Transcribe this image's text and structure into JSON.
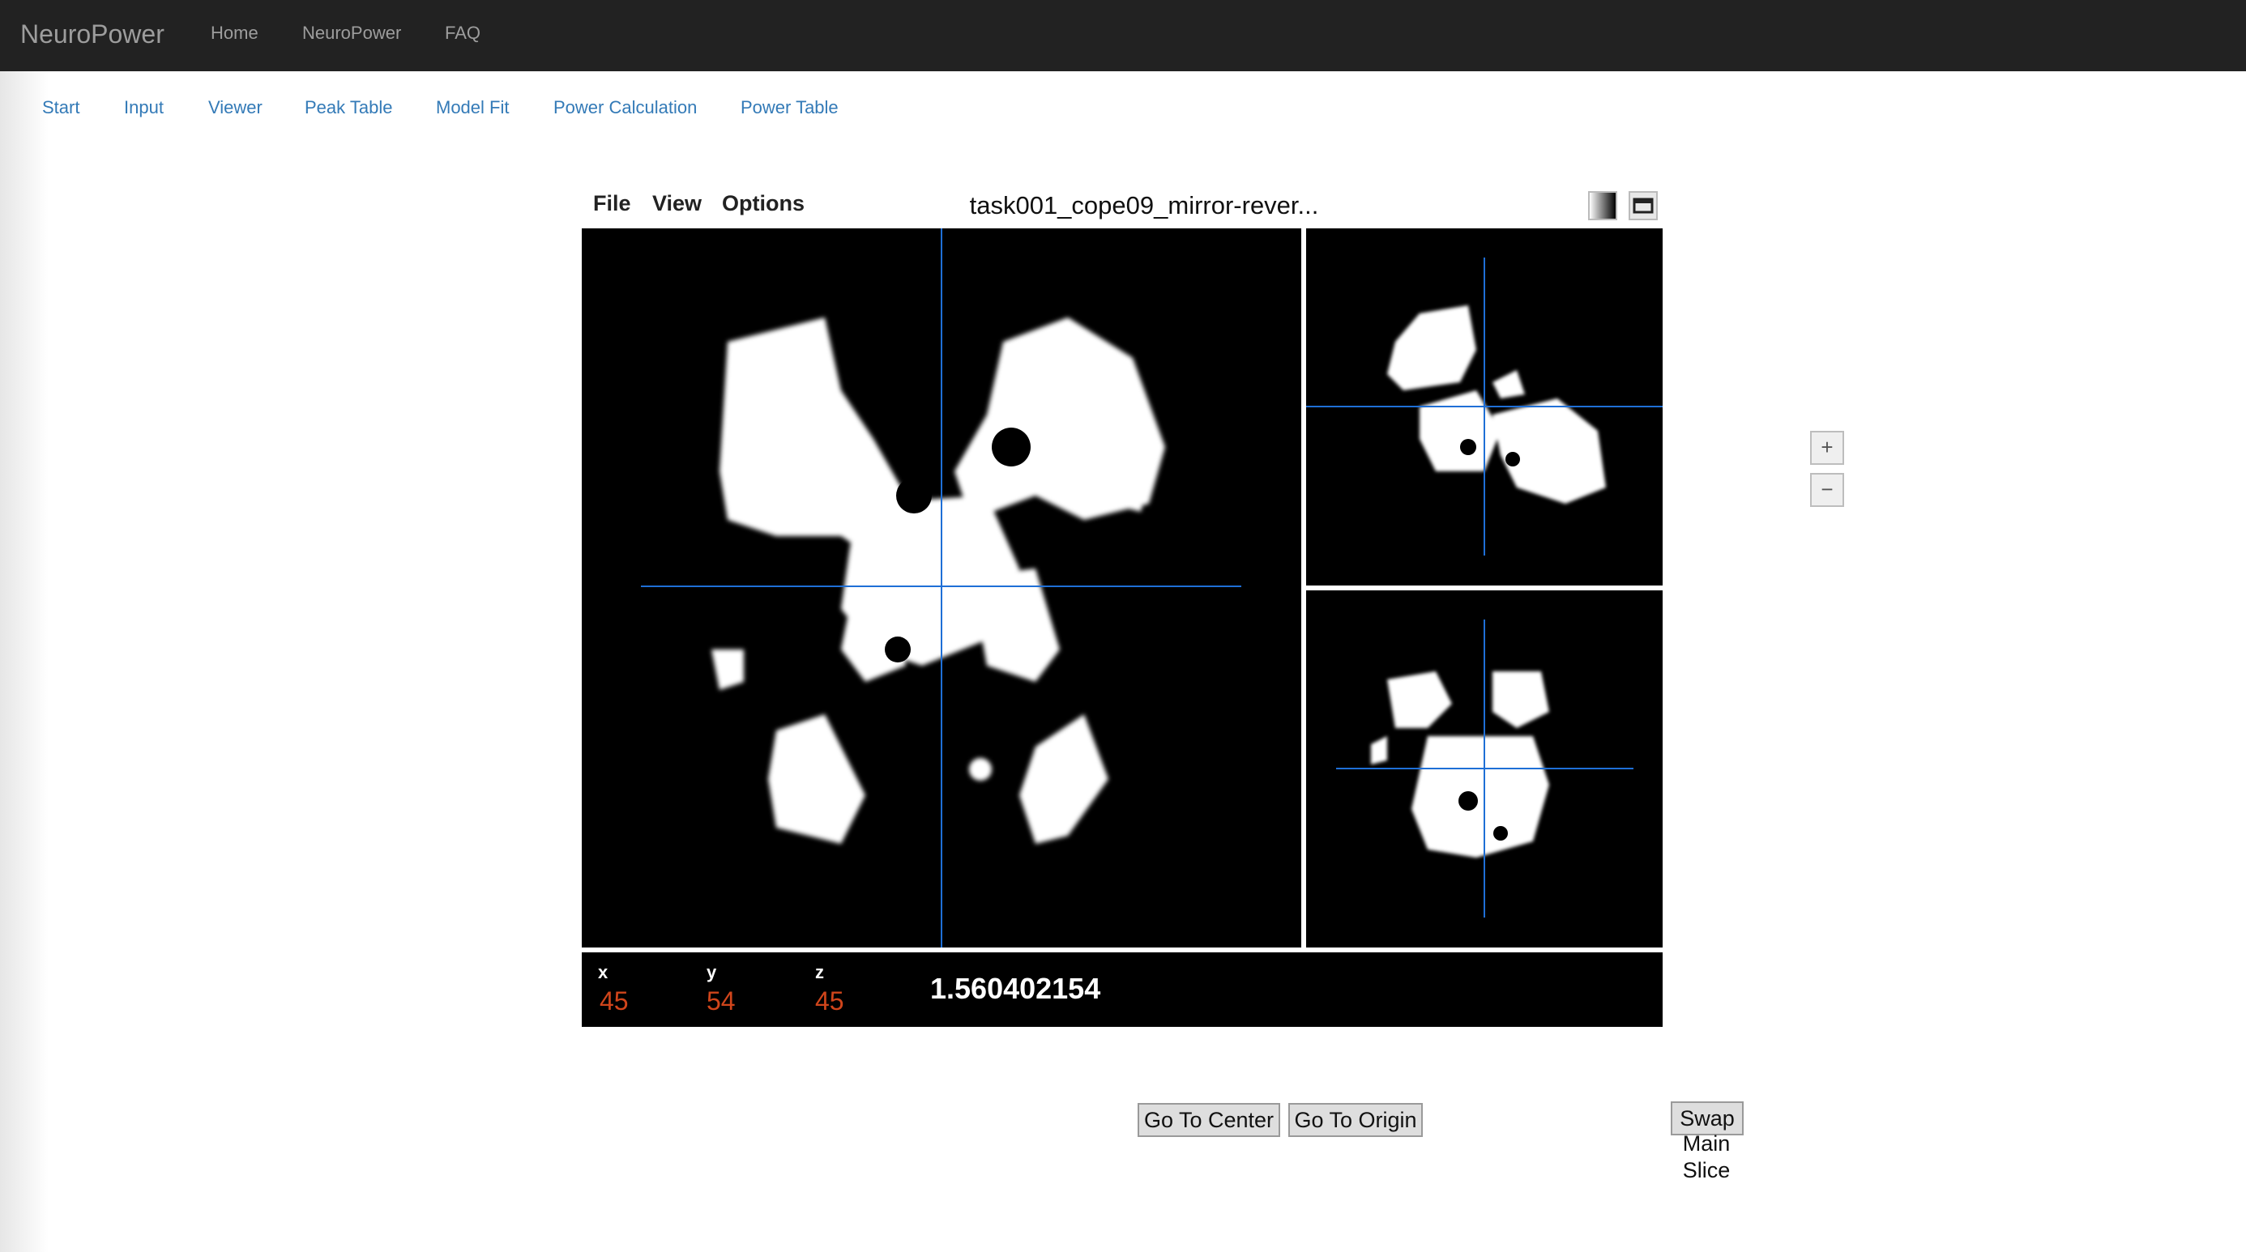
{
  "navbar": {
    "brand": "NeuroPower",
    "links": [
      "Home",
      "NeuroPower",
      "FAQ"
    ]
  },
  "tabs": [
    "Start",
    "Input",
    "Viewer",
    "Peak Table",
    "Model Fit",
    "Power Calculation",
    "Power Table"
  ],
  "viewer": {
    "menus": [
      "File",
      "View",
      "Options"
    ],
    "title": "task001_cope09_mirror-rever...",
    "coords": {
      "x_label": "x",
      "x": "45",
      "y_label": "y",
      "y": "54",
      "z_label": "z",
      "z": "45"
    },
    "intensity": "1.560402154",
    "zoom_in": "+",
    "zoom_out": "−"
  },
  "buttons": {
    "go_center": "Go To Center",
    "go_origin": "Go To Origin",
    "swap": "Swap",
    "swap_sub": "Main Slice"
  },
  "colors": {
    "navbar_bg": "#222222",
    "tab_link": "#337ab7",
    "crosshair": "#1f6fd6",
    "coord_value": "#d0451b"
  }
}
